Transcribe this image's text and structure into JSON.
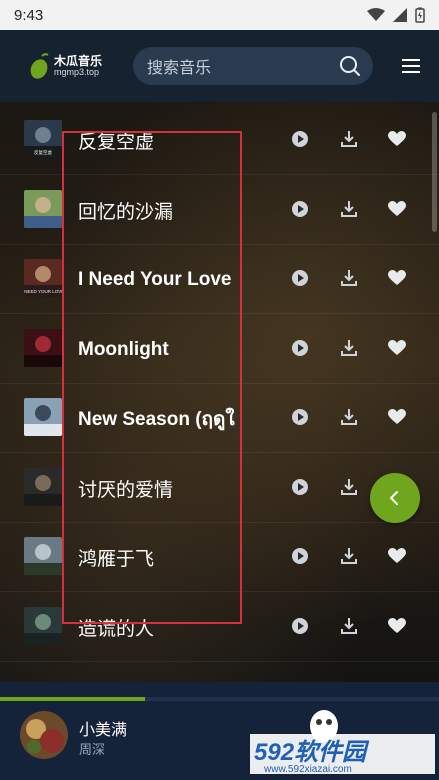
{
  "status_bar": {
    "time": "9:43"
  },
  "header": {
    "logo_name": "木瓜音乐",
    "logo_domain": "mgmp3.top",
    "search_placeholder": "搜索音乐"
  },
  "songs": [
    {
      "title": "反复空虚",
      "cover_label": "反复空虚"
    },
    {
      "title": "回忆的沙漏"
    },
    {
      "title": "I Need Your Love",
      "cover_label": "I NEED YOUR LOVE"
    },
    {
      "title": "Moonlight"
    },
    {
      "title": "New Season (ฤดูใ"
    },
    {
      "title": "讨厌的爱情"
    },
    {
      "title": "鸿雁于飞"
    },
    {
      "title": "造谎的人"
    }
  ],
  "player": {
    "title": "小美满",
    "artist": "周深",
    "progress": 0.33
  },
  "watermark": {
    "brand": "592软件园",
    "url": "www.592xiazai.com"
  },
  "colors": {
    "accent": "#6fa61e",
    "header_bg": "#172230",
    "player_bg": "#14223a",
    "highlight_box": "#d6303a"
  },
  "icons": {
    "play": "play-circle-icon",
    "download": "download-icon",
    "favorite": "heart-icon",
    "search": "search-icon",
    "menu": "hamburger-menu-icon",
    "fab": "chevron-left-icon"
  }
}
